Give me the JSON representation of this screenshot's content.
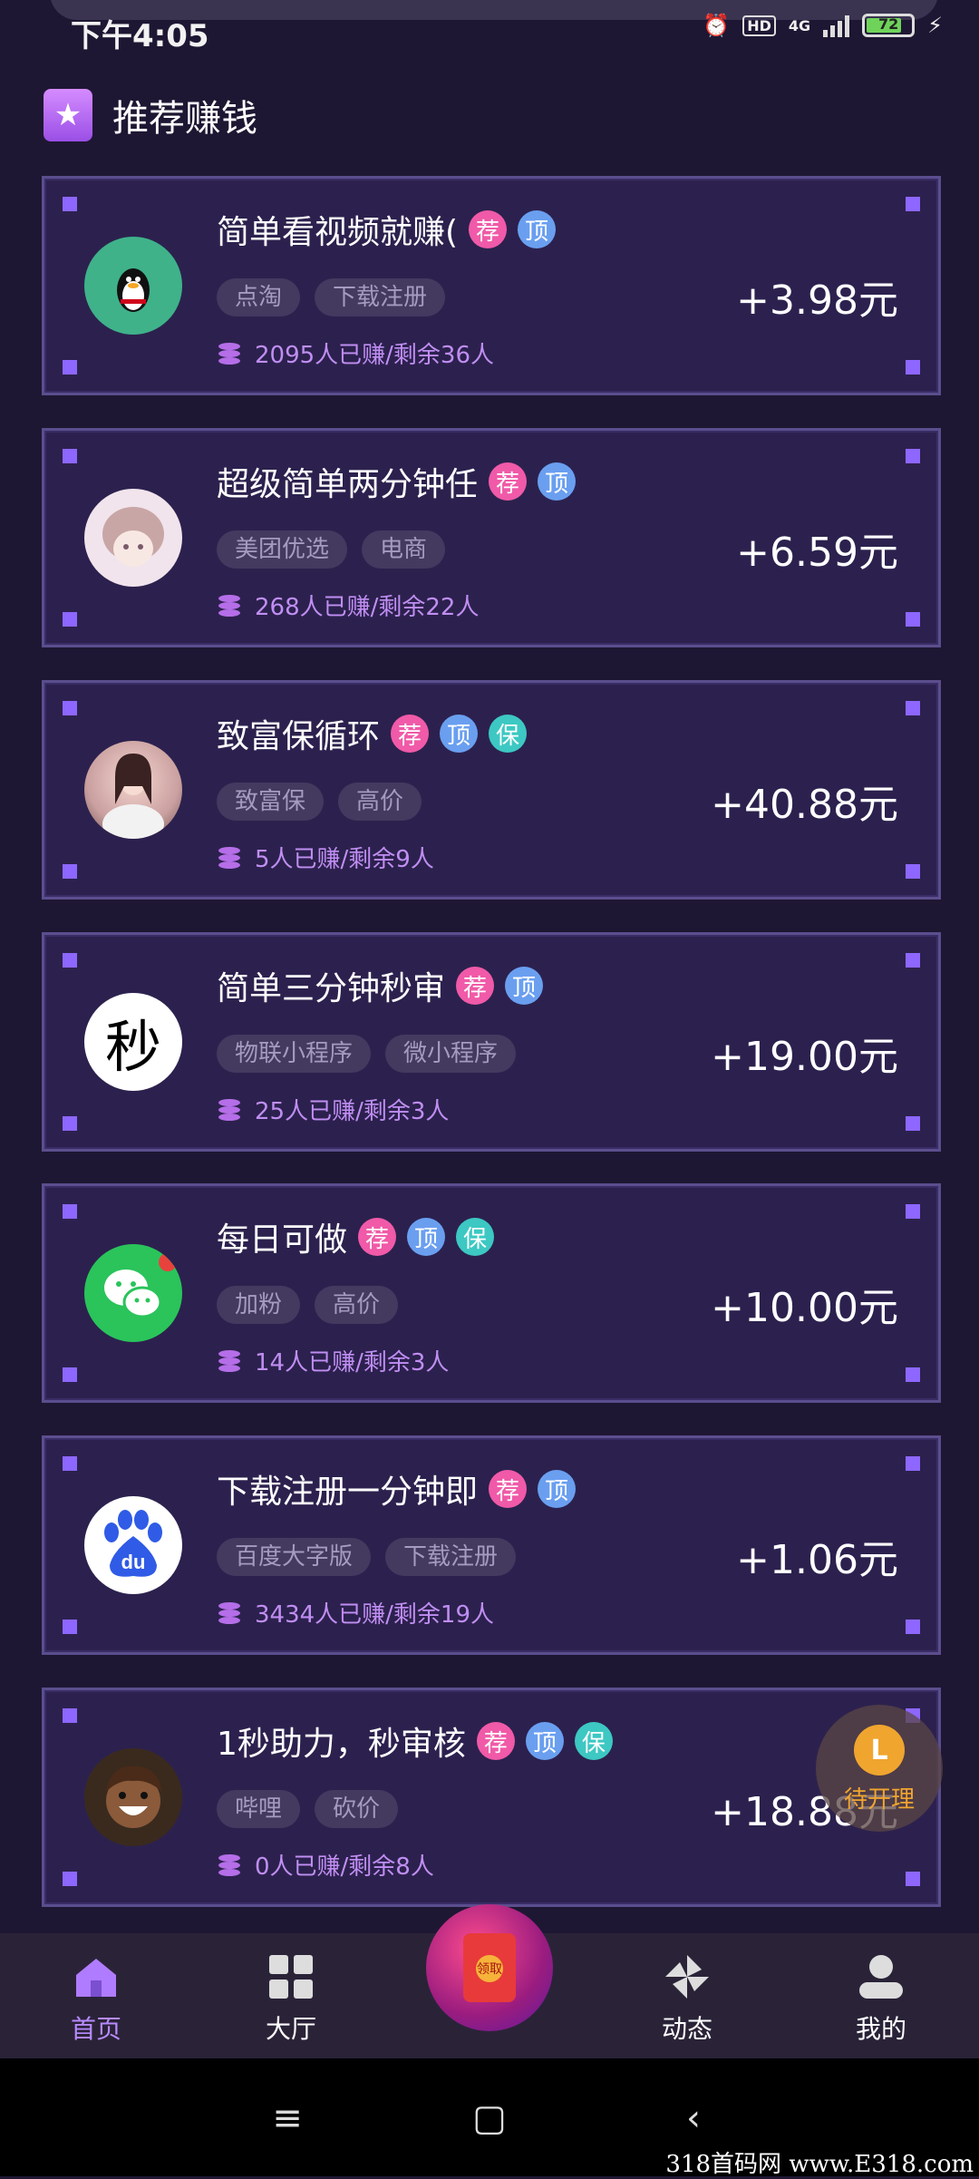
{
  "status": {
    "time": "下午4:05",
    "network": "4G",
    "hd": "HD",
    "battery": "72",
    "battery_level": 0.72
  },
  "section": {
    "title": "推荐赚钱",
    "icon": "star-icon"
  },
  "tasks": [
    {
      "title": "简单看视频就赚(",
      "badges": [
        "荐",
        "顶"
      ],
      "tags": [
        "点淘",
        "下载注册"
      ],
      "stats": "2095人已赚/剩余36人",
      "price": "+3.98元",
      "avatar": "qq-penguin"
    },
    {
      "title": "超级简单两分钟任",
      "badges": [
        "荐",
        "顶"
      ],
      "tags": [
        "美团优选",
        "电商"
      ],
      "stats": "268人已赚/剩余22人",
      "price": "+6.59元",
      "avatar": "anime-avatar"
    },
    {
      "title": "致富保循环",
      "badges": [
        "荐",
        "顶",
        "保"
      ],
      "tags": [
        "致富保",
        "高价"
      ],
      "stats": "5人已赚/剩余9人",
      "price": "+40.88元",
      "avatar": "girl-photo"
    },
    {
      "title": "简单三分钟秒审",
      "badges": [
        "荐",
        "顶"
      ],
      "tags": [
        "物联小程序",
        "微小程序"
      ],
      "stats": "25人已赚/剩余3人",
      "price": "+19.00元",
      "avatar": "miao-char",
      "avatar_text": "秒"
    },
    {
      "title": "每日可做",
      "badges": [
        "荐",
        "顶",
        "保"
      ],
      "tags": [
        "加粉",
        "高价"
      ],
      "stats": "14人已赚/剩余3人",
      "price": "+10.00元",
      "avatar": "wechat-logo"
    },
    {
      "title": "下载注册一分钟即",
      "badges": [
        "荐",
        "顶"
      ],
      "tags": [
        "百度大字版",
        "下载注册"
      ],
      "stats": "3434人已赚/剩余19人",
      "price": "+1.06元",
      "avatar": "baidu-logo",
      "avatar_text": "du"
    },
    {
      "title": "1秒助力，秒审核",
      "badges": [
        "荐",
        "顶",
        "保"
      ],
      "tags": [
        "哔哩",
        "砍价"
      ],
      "stats": "0人已赚/剩余8人",
      "price": "+18.88元",
      "avatar": "cartoon-boy"
    }
  ],
  "float_button": {
    "label": "待开理",
    "coin": "L"
  },
  "center_button": {
    "label": "领取"
  },
  "nav": [
    {
      "label": "首页",
      "icon": "home-icon",
      "active": true
    },
    {
      "label": "大厅",
      "icon": "grid-icon",
      "active": false
    },
    {
      "label": "动态",
      "icon": "pinwheel-icon",
      "active": false
    },
    {
      "label": "我的",
      "icon": "user-icon",
      "active": false
    }
  ],
  "watermark": "318首码网 www.E318.com"
}
